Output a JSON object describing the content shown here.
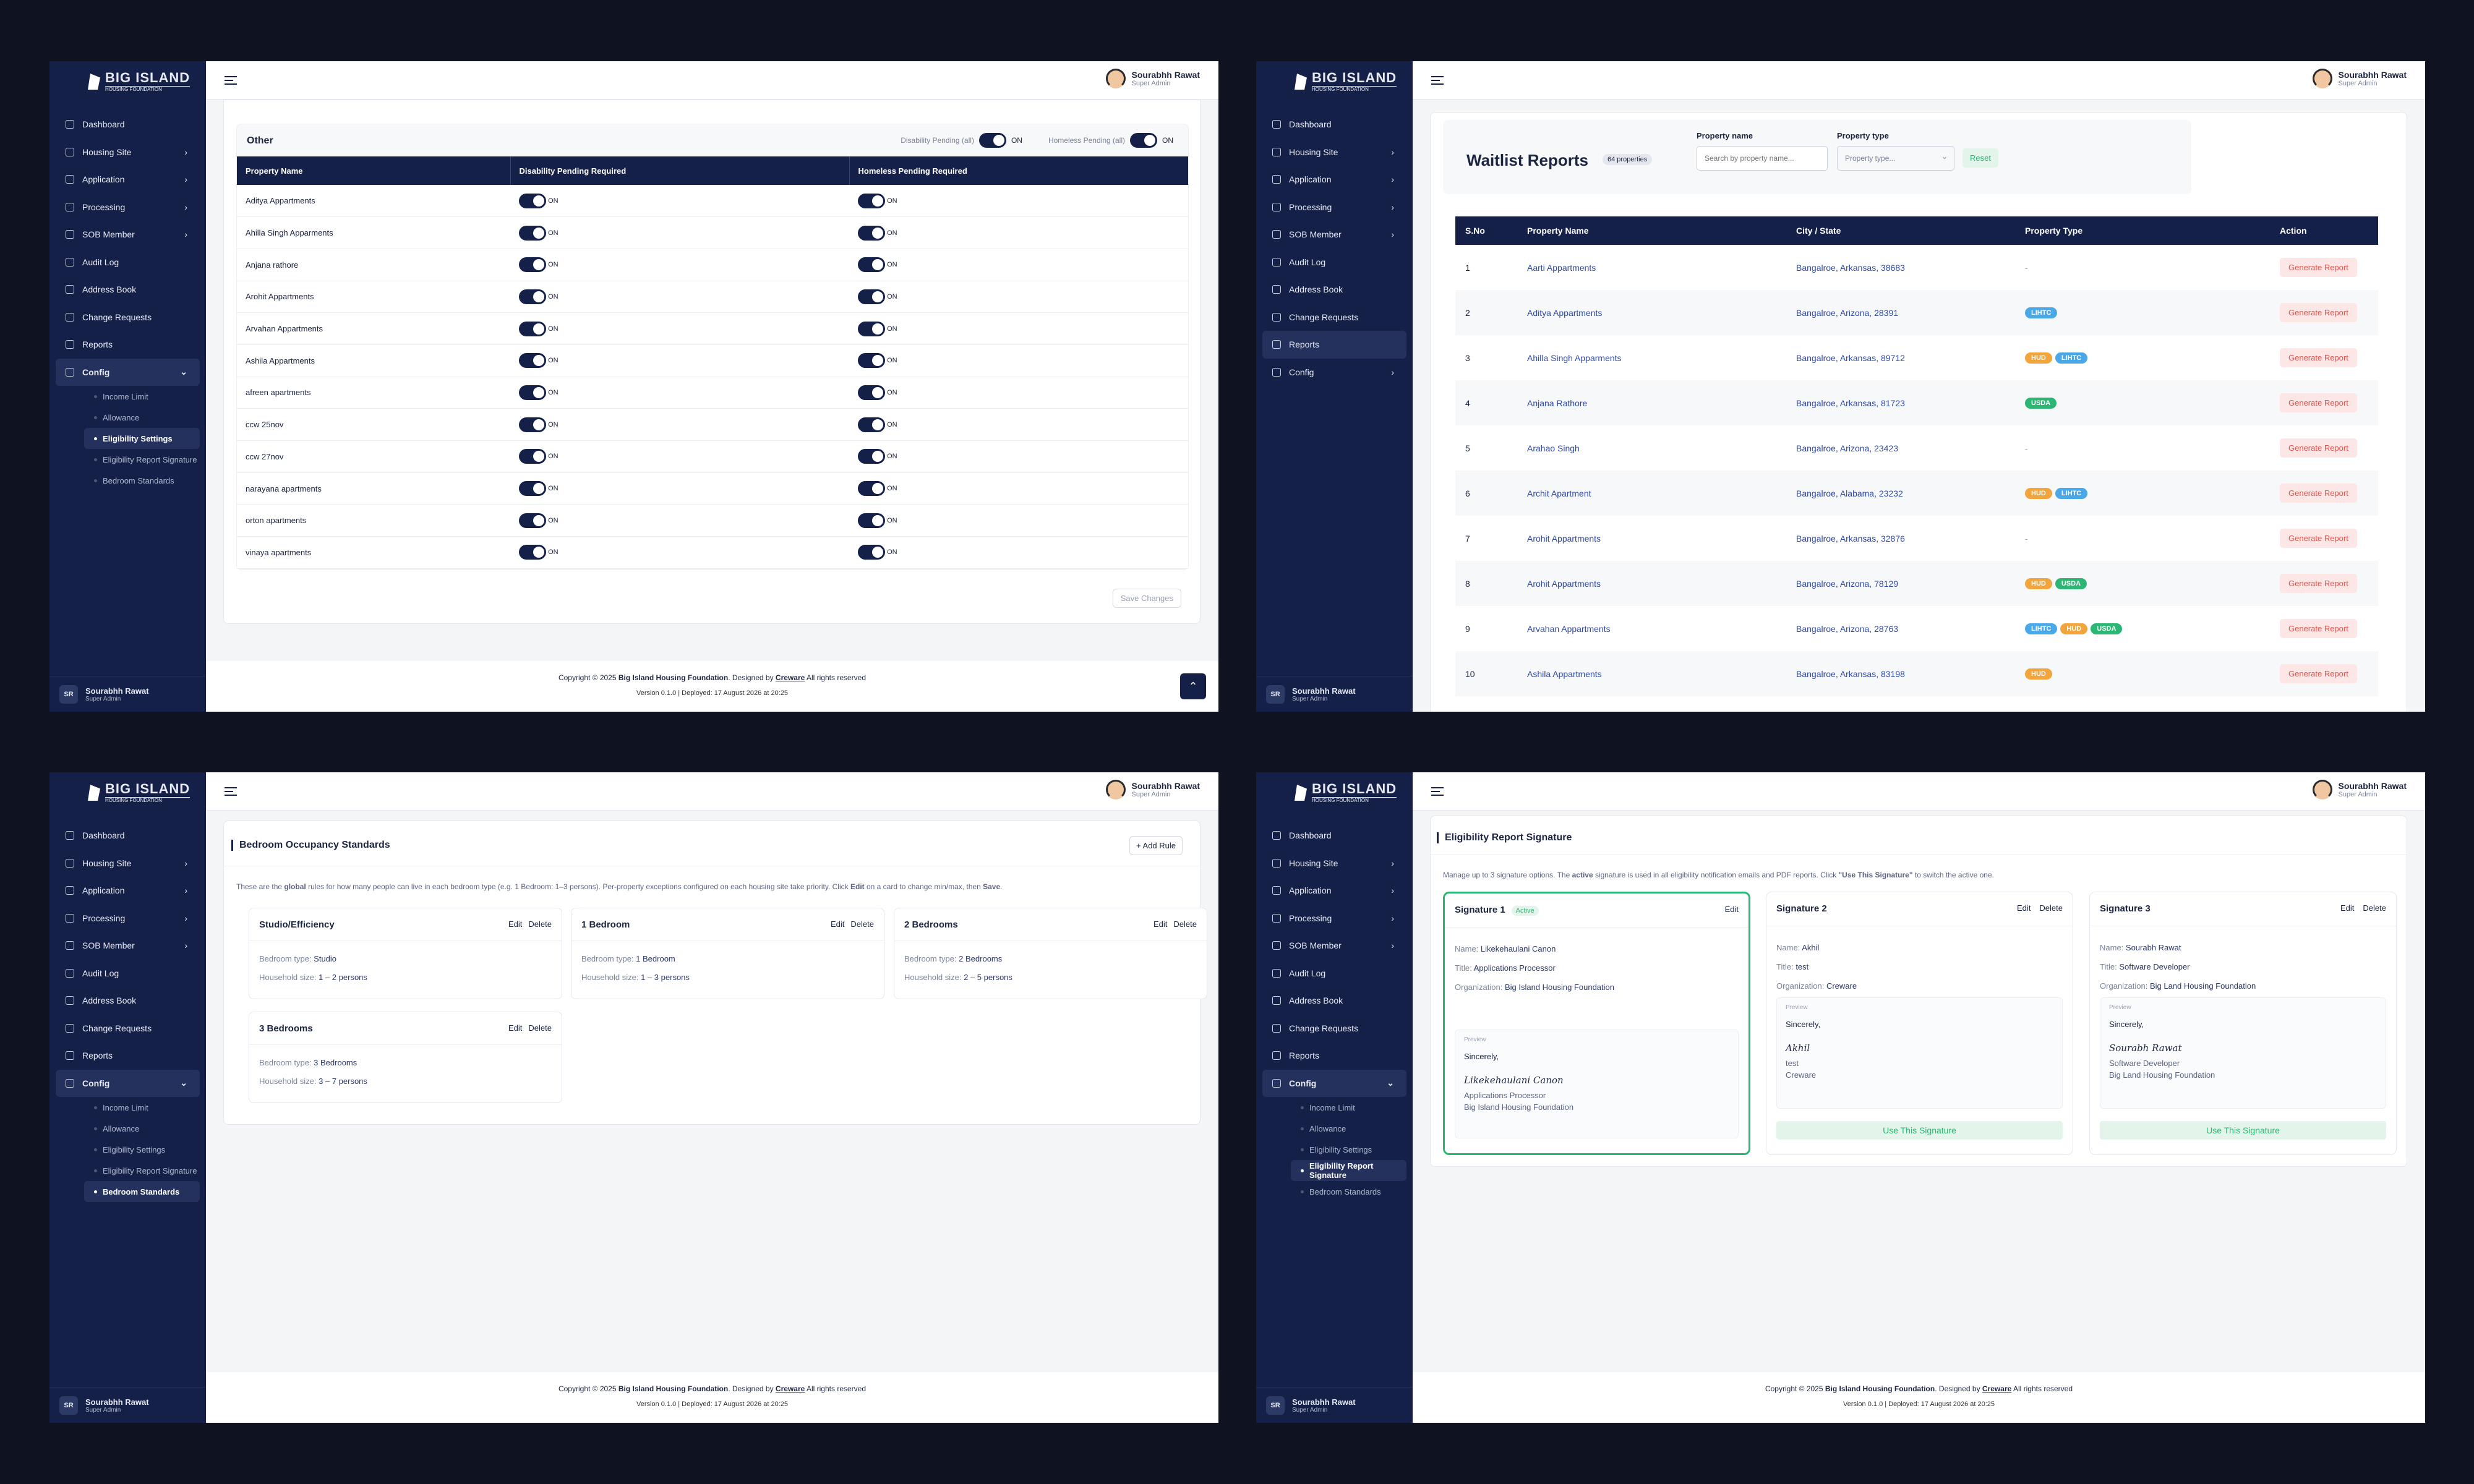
{
  "brand": {
    "name": "BIG ISLAND",
    "sub": "HOUSING FOUNDATION"
  },
  "user": {
    "name": "Sourabhh Rawat",
    "role": "Super Admin",
    "initials": "SR"
  },
  "nav": [
    {
      "label": "Dashboard"
    },
    {
      "label": "Housing Site",
      "chevron": "›"
    },
    {
      "label": "Application",
      "chevron": "›"
    },
    {
      "label": "Processing",
      "chevron": "›"
    },
    {
      "label": "SOB Member",
      "chevron": "›"
    },
    {
      "label": "Audit Log"
    },
    {
      "label": "Address Book"
    },
    {
      "label": "Change Requests"
    },
    {
      "label": "Reports"
    },
    {
      "label": "Config",
      "chevron": "›"
    }
  ],
  "config_sub": [
    "Income Limit",
    "Allowance",
    "Eligibility Settings",
    "Eligibility Report Signature",
    "Bedroom Standards"
  ],
  "footer": {
    "pre": "Copyright © 2025 ",
    "org": "Big Island Housing Foundation",
    "mid": ". Designed by ",
    "designer": "Creware",
    "post": " All rights reserved",
    "version": "Version 0.1.0 | Deployed: 17 August 2026 at 20:25"
  },
  "p1": {
    "section_title": "Other",
    "dis_all": "Disability Pending (all)",
    "hom_all": "Homeless Pending (all)",
    "on": "ON",
    "headers": [
      "Property Name",
      "Disability Pending Required",
      "Homeless Pending Required"
    ],
    "rows": [
      "Aditya Appartments",
      "Ahilla Singh Apparments",
      "Anjana rathore",
      "Arohit Appartments",
      "Arvahan Appartments",
      "Ashila Appartments",
      "afreen apartments",
      "ccw 25nov",
      "ccw 27nov",
      "narayana apartments",
      "orton apartments",
      "vinaya apartments"
    ],
    "save": "Save Changes"
  },
  "p2": {
    "title": "Waitlist Reports",
    "count": "64 properties",
    "prop_name_label": "Property name",
    "prop_name_ph": "Search by property name...",
    "prop_type_label": "Property type",
    "prop_type_ph": "Property type...",
    "reset": "Reset",
    "headers": [
      "S.No",
      "Property Name",
      "City / State",
      "Property Type",
      "Action"
    ],
    "action": "Generate Report",
    "rows": [
      {
        "no": "1",
        "name": "Aarti Appartments",
        "city": "Bangalroe, Arkansas, 38683",
        "types": []
      },
      {
        "no": "2",
        "name": "Aditya Appartments",
        "city": "Bangalroe, Arizona, 28391",
        "types": [
          "LIHTC"
        ]
      },
      {
        "no": "3",
        "name": "Ahilla Singh Apparments",
        "city": "Bangalroe, Arkansas, 89712",
        "types": [
          "HUD",
          "LIHTC"
        ]
      },
      {
        "no": "4",
        "name": "Anjana Rathore",
        "city": "Bangalroe, Arkansas, 81723",
        "types": [
          "USDA"
        ]
      },
      {
        "no": "5",
        "name": "Arahao Singh",
        "city": "Bangalroe, Arizona, 23423",
        "types": []
      },
      {
        "no": "6",
        "name": "Archit Apartment",
        "city": "Bangalroe, Alabama, 23232",
        "types": [
          "HUD",
          "LIHTC"
        ]
      },
      {
        "no": "7",
        "name": "Arohit Appartments",
        "city": "Bangalroe, Arkansas, 32876",
        "types": []
      },
      {
        "no": "8",
        "name": "Arohit Appartments",
        "city": "Bangalroe, Arizona, 78129",
        "types": [
          "HUD",
          "USDA"
        ]
      },
      {
        "no": "9",
        "name": "Arvahan Appartments",
        "city": "Bangalroe, Arizona, 28763",
        "types": [
          "LIHTC",
          "HUD",
          "USDA"
        ]
      },
      {
        "no": "10",
        "name": "Ashila Appartments",
        "city": "Bangalroe, Arkansas, 83198",
        "types": [
          "HUD"
        ]
      }
    ],
    "dash": "-"
  },
  "p3": {
    "title": "Bedroom Occupancy Standards",
    "add": "+ Add Rule",
    "desc_pre": "These are the ",
    "desc_b1": "global",
    "desc_mid": " rules for how many people can live in each bedroom type (e.g. 1 Bedroom: 1–3 persons). Per-property exceptions configured on each housing site take priority. Click ",
    "desc_b2": "Edit",
    "desc_mid2": " on a card to change min/max, then ",
    "desc_b3": "Save",
    "desc_end": ".",
    "edit": "Edit",
    "delete": "Delete",
    "type_label": "Bedroom type: ",
    "size_label": "Household size: ",
    "cards": [
      {
        "name": "Studio/Efficiency",
        "type": "Studio",
        "size": "1 – 2 persons"
      },
      {
        "name": "1 Bedroom",
        "type": "1 Bedroom",
        "size": "1 – 3 persons"
      },
      {
        "name": "2 Bedrooms",
        "type": "2 Bedrooms",
        "size": "2 – 5 persons"
      },
      {
        "name": "3 Bedrooms",
        "type": "3 Bedrooms",
        "size": "3 – 7 persons"
      }
    ]
  },
  "p4": {
    "title": "Eligibility Report Signature",
    "desc_pre": "Manage up to 3 signature options. The ",
    "desc_b": "active",
    "desc_mid": " signature is used in all eligibility notification emails and PDF reports. Click ",
    "desc_q": "\"Use This Signature\"",
    "desc_end": " to switch the active one.",
    "active": "Active",
    "edit": "Edit",
    "delete": "Delete",
    "use": "Use This Signature",
    "preview": "Preview",
    "sincerely": "Sincerely,",
    "name_l": "Name: ",
    "title_l": "Title: ",
    "org_l": "Organization: ",
    "sigs": [
      {
        "label": "Signature 1",
        "name": "Likekehaulani Canon",
        "title": "Applications Processor",
        "org": "Big Island Housing Foundation"
      },
      {
        "label": "Signature 2",
        "name": "Akhil",
        "title": "test",
        "org": "Creware"
      },
      {
        "label": "Signature 3",
        "name": "Sourabh Rawat",
        "title": "Software Developer",
        "org": "Big Land Housing Foundation"
      }
    ]
  },
  "icons": {
    "nav": "nav-icon",
    "chevron": "chevron-right-icon",
    "menu": "hamburger-icon",
    "up": "arrow-up-icon"
  },
  "colors": {
    "sidebar": "#152048",
    "accent": "#152048",
    "active_border": "#2bb673",
    "danger": "#e0544d"
  }
}
